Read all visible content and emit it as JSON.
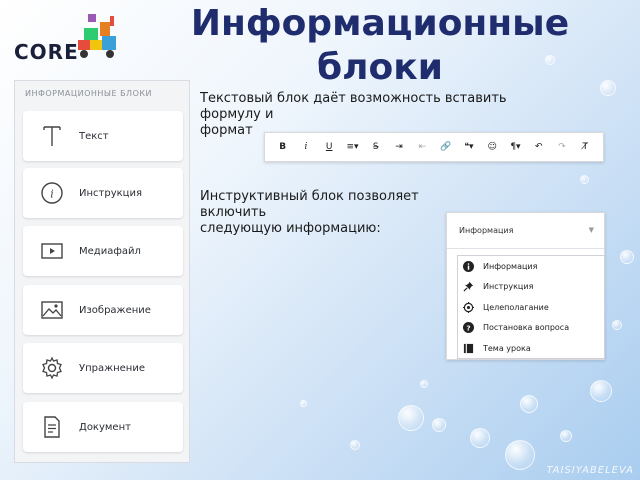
{
  "logo": {
    "text": "CORE"
  },
  "title": "Информационные блоки",
  "sidebar": {
    "header": "ИНФОРМАЦИОННЫЕ БЛОКИ",
    "items": [
      {
        "label": "Текст",
        "icon": "text-icon"
      },
      {
        "label": "Инструкция",
        "icon": "info-icon"
      },
      {
        "label": "Медиафайл",
        "icon": "play-icon"
      },
      {
        "label": "Изображение",
        "icon": "image-icon"
      },
      {
        "label": "Упражнение",
        "icon": "gear-icon"
      },
      {
        "label": "Документ",
        "icon": "document-icon"
      }
    ]
  },
  "text_block": {
    "line1": "Текстовый блок даёт возможность вставить",
    "line2": "формулу и",
    "line3": "формат"
  },
  "toolbar": {
    "buttons": [
      {
        "label": "B",
        "icon": "bold-icon"
      },
      {
        "label": "i",
        "icon": "italic-icon"
      },
      {
        "label": "U",
        "icon": "underline-icon"
      },
      {
        "label": "≡▾",
        "icon": "align-icon"
      },
      {
        "label": "S̶",
        "icon": "strikethrough-icon"
      },
      {
        "label": "⇥",
        "icon": "indent-icon"
      },
      {
        "label": "⇤",
        "icon": "outdent-icon"
      },
      {
        "label": "🔗",
        "icon": "link-icon"
      },
      {
        "label": "❝▾",
        "icon": "quote-icon"
      },
      {
        "label": "☺",
        "icon": "emoji-icon"
      },
      {
        "label": "¶▾",
        "icon": "paragraph-icon"
      },
      {
        "label": "↶",
        "icon": "undo-icon"
      },
      {
        "label": "↷",
        "icon": "redo-icon"
      },
      {
        "label": "T̸",
        "icon": "clear-format-icon"
      }
    ]
  },
  "instruction_block": {
    "line1": "Инструктивный блок позволяет",
    "line2": "включить",
    "line3": "следующую информацию:"
  },
  "dropdown": {
    "selected": "Информация",
    "options": [
      {
        "label": "Информация",
        "icon": "info-circle-icon"
      },
      {
        "label": "Инструкция",
        "icon": "pin-icon"
      },
      {
        "label": "Целеполагание",
        "icon": "target-icon"
      },
      {
        "label": "Постановка вопроса",
        "icon": "question-circle-icon"
      },
      {
        "label": "Тема урока",
        "icon": "book-icon"
      }
    ]
  },
  "watermark": "TAISIYABELEVA"
}
